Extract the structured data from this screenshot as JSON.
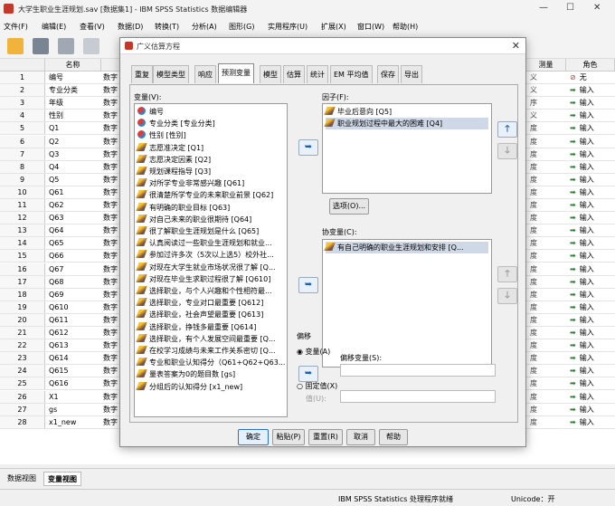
{
  "window": {
    "title": "大学生职业生涯规划.sav [数据集1] - IBM SPSS Statistics 数据编辑器"
  },
  "menu": [
    "文件(F)",
    "编辑(E)",
    "查看(V)",
    "数据(D)",
    "转换(T)",
    "分析(A)",
    "图形(G)",
    "实用程序(U)",
    "扩展(X)",
    "窗口(W)",
    "帮助(H)"
  ],
  "grid": {
    "headers": {
      "name": "名称",
      "measure": "测量",
      "role": "角色"
    },
    "type_text": "数字",
    "rows": [
      {
        "n": "1",
        "name": "编号",
        "ms": "义",
        "role": "无",
        "role_icon": "none"
      },
      {
        "n": "2",
        "name": "专业分类",
        "ms": "义",
        "role": "输入"
      },
      {
        "n": "3",
        "name": "年级",
        "ms": "序",
        "role": "输入"
      },
      {
        "n": "4",
        "name": "性别",
        "ms": "义",
        "role": "输入"
      },
      {
        "n": "5",
        "name": "Q1",
        "ms": "度",
        "role": "输入"
      },
      {
        "n": "6",
        "name": "Q2",
        "ms": "度",
        "role": "输入"
      },
      {
        "n": "7",
        "name": "Q3",
        "ms": "度",
        "role": "输入"
      },
      {
        "n": "8",
        "name": "Q4",
        "ms": "度",
        "role": "输入"
      },
      {
        "n": "9",
        "name": "Q5",
        "ms": "度",
        "role": "输入"
      },
      {
        "n": "10",
        "name": "Q61",
        "ms": "度",
        "role": "输入"
      },
      {
        "n": "11",
        "name": "Q62",
        "ms": "度",
        "role": "输入"
      },
      {
        "n": "12",
        "name": "Q63",
        "ms": "度",
        "role": "输入"
      },
      {
        "n": "13",
        "name": "Q64",
        "ms": "度",
        "role": "输入"
      },
      {
        "n": "14",
        "name": "Q65",
        "ms": "度",
        "role": "输入"
      },
      {
        "n": "15",
        "name": "Q66",
        "ms": "度",
        "role": "输入"
      },
      {
        "n": "16",
        "name": "Q67",
        "ms": "度",
        "role": "输入"
      },
      {
        "n": "17",
        "name": "Q68",
        "ms": "度",
        "role": "输入"
      },
      {
        "n": "18",
        "name": "Q69",
        "ms": "度",
        "role": "输入"
      },
      {
        "n": "19",
        "name": "Q610",
        "ms": "度",
        "role": "输入"
      },
      {
        "n": "20",
        "name": "Q611",
        "ms": "度",
        "role": "输入"
      },
      {
        "n": "21",
        "name": "Q612",
        "ms": "度",
        "role": "输入"
      },
      {
        "n": "22",
        "name": "Q613",
        "ms": "度",
        "role": "输入"
      },
      {
        "n": "23",
        "name": "Q614",
        "ms": "度",
        "role": "输入"
      },
      {
        "n": "24",
        "name": "Q615",
        "ms": "度",
        "role": "输入"
      },
      {
        "n": "25",
        "name": "Q616",
        "ms": "度",
        "role": "输入"
      },
      {
        "n": "26",
        "name": "X1",
        "ms": "度",
        "role": "输入"
      },
      {
        "n": "27",
        "name": "gs",
        "ms": "度",
        "role": "输入"
      },
      {
        "n": "28",
        "name": "x1_new",
        "ms": "度",
        "role": "输入"
      }
    ]
  },
  "bottom_tabs": {
    "data_view": "数据视图",
    "variable_view": "变量视图"
  },
  "status": {
    "processor": "IBM SPSS Statistics 处理程序就绪",
    "unicode": "Unicode：开"
  },
  "dialog": {
    "title": "广义估算方程",
    "tabs": [
      "重复",
      "模型类型",
      "响应",
      "预测变量",
      "模型",
      "估算",
      "统计",
      "EM 平均值",
      "保存",
      "导出"
    ],
    "active_tab": "预测变量",
    "variables_label": "变量(V):",
    "variables": [
      {
        "label": "编号",
        "kind": "nominal"
      },
      {
        "label": "专业分类 [专业分类]",
        "kind": "nominal"
      },
      {
        "label": "性别 [性别]",
        "kind": "nominal"
      },
      {
        "label": "志愿准决定 [Q1]",
        "kind": "scale"
      },
      {
        "label": "志愿决定因素 [Q2]",
        "kind": "scale"
      },
      {
        "label": "规划课程指导 [Q3]",
        "kind": "scale"
      },
      {
        "label": "对所学专业非常感兴趣 [Q61]",
        "kind": "scale"
      },
      {
        "label": "很清楚所学专业的未来职业前景 [Q62]",
        "kind": "scale"
      },
      {
        "label": "有明确的职业目标 [Q63]",
        "kind": "scale"
      },
      {
        "label": "对自己未来的职业很期待 [Q64]",
        "kind": "scale"
      },
      {
        "label": "很了解职业生涯规划是什么 [Q65]",
        "kind": "scale"
      },
      {
        "label": "认真阅读过一些职业生涯规划和就业...",
        "kind": "scale"
      },
      {
        "label": "参加过许多次（5次以上选5）校外社...",
        "kind": "scale"
      },
      {
        "label": "对现在大学生就业市场状况很了解 [Q...",
        "kind": "scale"
      },
      {
        "label": "对现在毕业生求职过程很了解 [Q610]",
        "kind": "scale"
      },
      {
        "label": "选择职业，与个人兴趣和个性相符最...",
        "kind": "scale"
      },
      {
        "label": "选择职业，专业对口最重要 [Q612]",
        "kind": "scale"
      },
      {
        "label": "选择职业，社会声望最重要 [Q613]",
        "kind": "scale"
      },
      {
        "label": "选择职业，挣钱多最重要 [Q614]",
        "kind": "scale"
      },
      {
        "label": "选择职业，有个人发展空间最重要 [Q...",
        "kind": "scale"
      },
      {
        "label": "在校学习成绩与未来工作关系密切 [Q...",
        "kind": "scale"
      },
      {
        "label": "专业和职业认知得分（Q61+Q62+Q63...",
        "kind": "scale"
      },
      {
        "label": "量表答案为0的题目数 [gs]",
        "kind": "scale"
      },
      {
        "label": "分组后的认知得分 [x1_new]",
        "kind": "scale"
      }
    ],
    "factors_label": "因子(F):",
    "factors": [
      {
        "label": "毕业后意向 [Q5]",
        "selected": false
      },
      {
        "label": "职业规划过程中最大的困难 [Q4]",
        "selected": true
      }
    ],
    "options_button": "选项(O)...",
    "covariates_label": "协变量(C):",
    "covariates": [
      {
        "label": "有自己明确的职业生涯规划和安排 [Q...",
        "selected": true
      }
    ],
    "offset": {
      "group_label": "偏移",
      "variable_radio": "变量(A)",
      "offset_var_label": "偏移变量(S):",
      "fixed_radio": "固定值(X)",
      "value_label": "值(U):"
    },
    "buttons": {
      "ok": "确定",
      "paste": "粘贴(P)",
      "reset": "重置(R)",
      "cancel": "取消",
      "help": "帮助"
    }
  }
}
